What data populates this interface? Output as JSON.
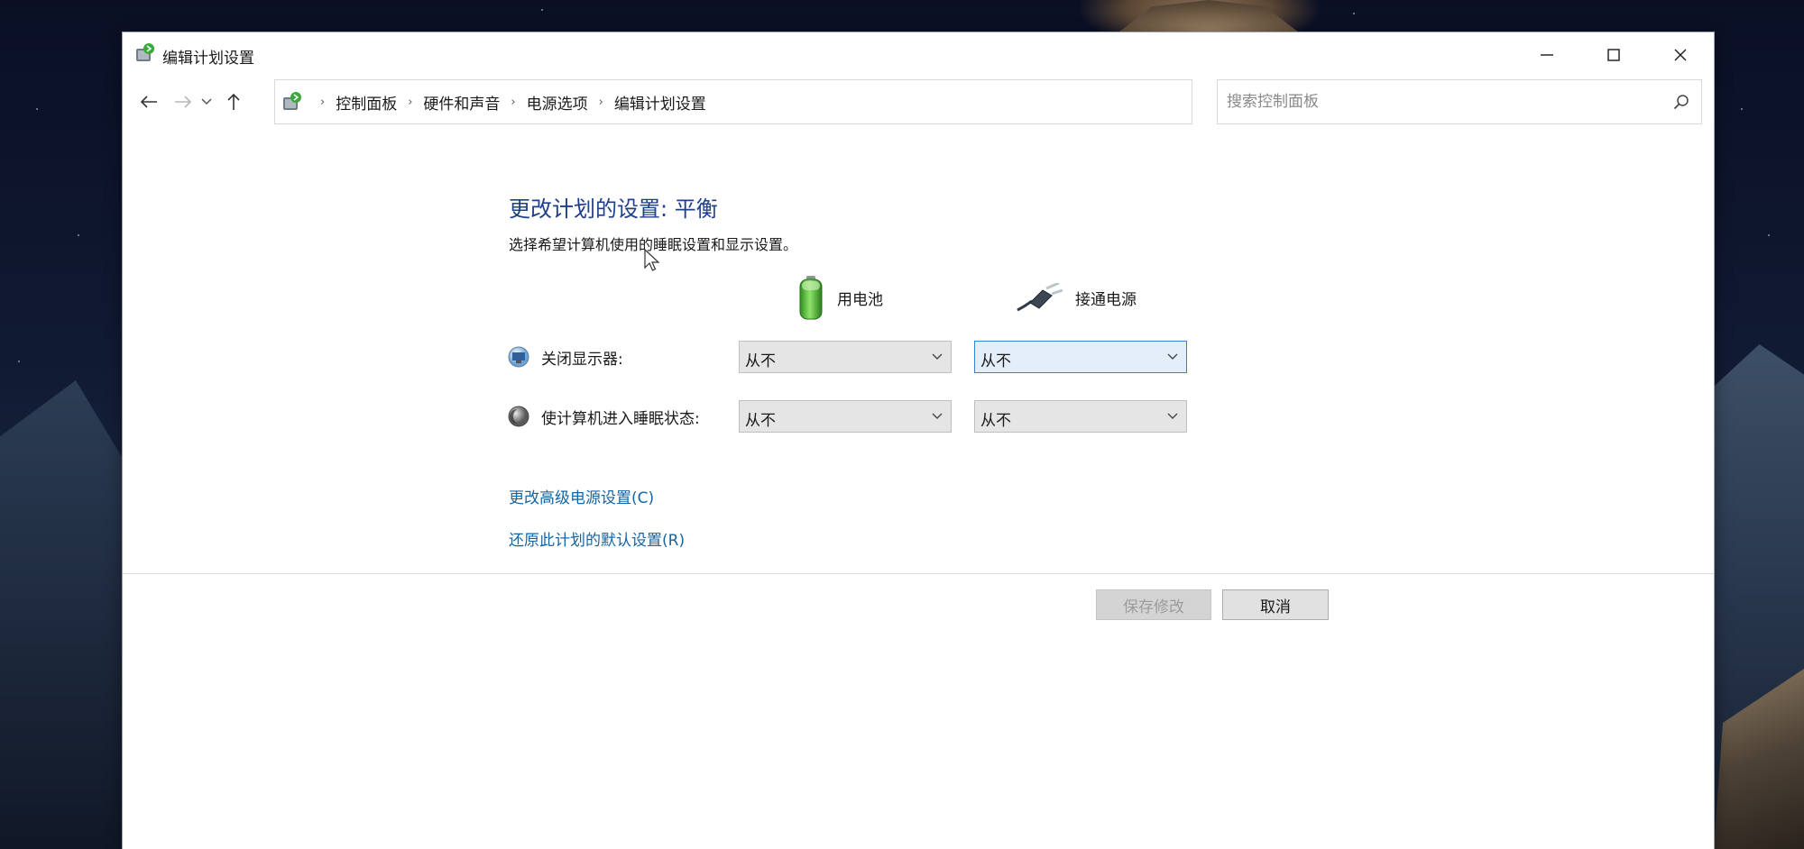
{
  "window": {
    "title": "编辑计划设置"
  },
  "nav": {
    "breadcrumbs": [
      "控制面板",
      "硬件和声音",
      "电源选项",
      "编辑计划设置"
    ],
    "search_placeholder": "搜索控制面板"
  },
  "main": {
    "title": "更改计划的设置: 平衡",
    "description": "选择希望计算机使用的睡眠设置和显示设置。",
    "columns": {
      "battery": "用电池",
      "plugged_in": "接通电源"
    },
    "settings": [
      {
        "label": "关闭显示器:",
        "battery_value": "从不",
        "plugged_value": "从不"
      },
      {
        "label": "使计算机进入睡眠状态:",
        "battery_value": "从不",
        "plugged_value": "从不"
      }
    ],
    "links": {
      "advanced": "更改高级电源设置(C)",
      "restore": "还原此计划的默认设置(R)"
    },
    "buttons": {
      "save": "保存修改",
      "cancel": "取消"
    }
  },
  "colors": {
    "title_blue": "#1e3f8c",
    "link_blue": "#1565a5",
    "focus_blue": "#2f86d6"
  }
}
